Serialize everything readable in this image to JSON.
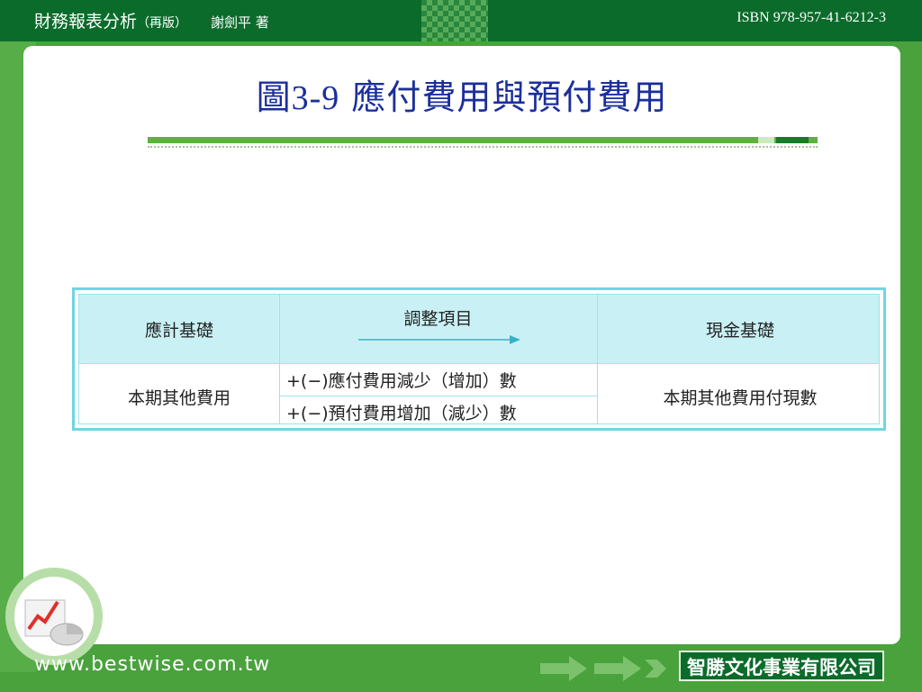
{
  "header": {
    "book_title": "財務報表分析",
    "edition": "（再版）",
    "author": "謝劍平 著",
    "isbn": "ISBN 978-957-41-6212-3"
  },
  "slide": {
    "title_prefix": "圖",
    "title_number": "3-9",
    "title_text": "應付費用與預付費用"
  },
  "table": {
    "headers": [
      "應計基礎",
      "調整項目",
      "現金基礎"
    ],
    "left_cell": "本期其他費用",
    "adjustments": [
      "+(−)應付費用減少（增加）數",
      "+(−)預付費用增加（減少）數"
    ],
    "right_cell": "本期其他費用付現數"
  },
  "footer": {
    "website": "www.bestwise.com.tw",
    "publisher": "智勝文化事業有限公司"
  },
  "colors": {
    "brand_green": "#0b6b2b",
    "accent_green": "#49a23c",
    "title_blue": "#1b2f9b",
    "table_header": "#c9f1f5",
    "table_border": "#6fd6e2"
  }
}
